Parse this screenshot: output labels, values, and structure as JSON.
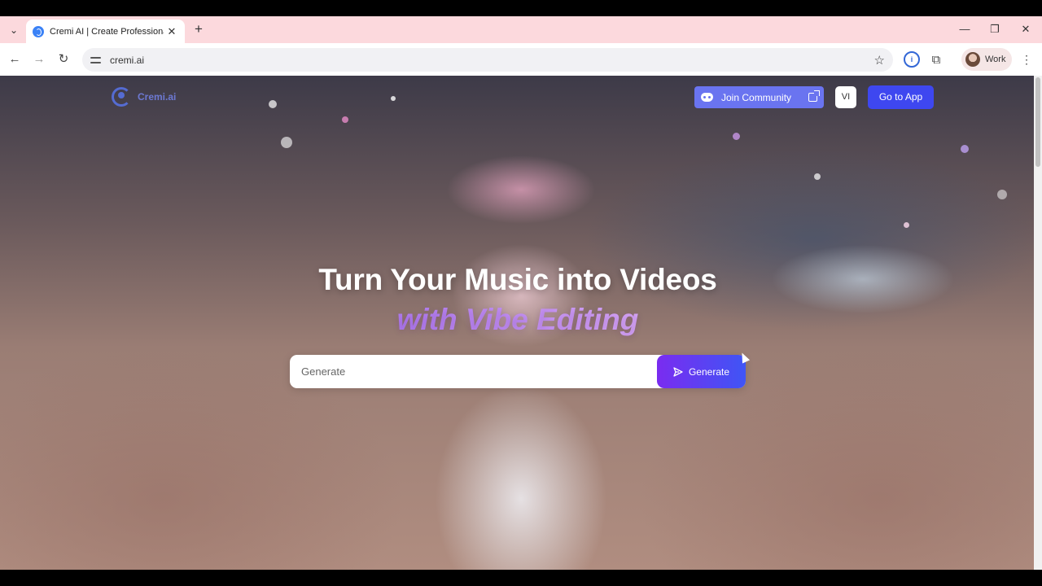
{
  "browser": {
    "tab": {
      "title": "Cremi AI | Create Professional V"
    },
    "new_tab_label": "+",
    "url": "cremi.ai",
    "profile_label": "Work",
    "window_controls": {
      "minimize": "—",
      "restore": "❐",
      "close": "✕"
    },
    "nav": {
      "back": "←",
      "forward": "→",
      "reload": "↻"
    }
  },
  "site": {
    "brand": "Cremi.ai",
    "join_community_label": "Join Community",
    "language_label": "VI",
    "go_to_app_label": "Go to App",
    "hero_title": "Turn Your Music into Videos",
    "hero_subtitle": "with Vibe Editing",
    "generate_placeholder": "Generate",
    "generate_button_label": "Generate"
  },
  "colors": {
    "tabbar": "#fcd9dd",
    "join_button": "#6a74f0",
    "go_to_app_button": "#3e47f0",
    "generate_gradient_start": "#7a2cf0",
    "generate_gradient_end": "#3f55f5",
    "subtitle": "#c79bf5"
  },
  "icons": [
    "tab-list-icon",
    "favicon-icon",
    "close-icon",
    "back-icon",
    "forward-icon",
    "reload-icon",
    "site-info-icon",
    "bookmark-star-icon",
    "password-manager-icon",
    "extensions-icon",
    "menu-icon",
    "discord-icon",
    "external-link-icon",
    "send-icon"
  ]
}
